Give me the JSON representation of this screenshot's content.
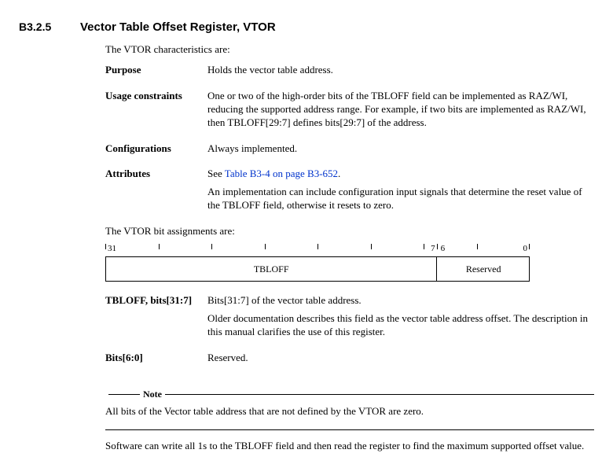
{
  "section": {
    "number": "B3.2.5",
    "title": "Vector Table Offset Register, VTOR"
  },
  "intro": "The VTOR characteristics are:",
  "characteristics": {
    "purpose": {
      "label": "Purpose",
      "text": "Holds the vector table address."
    },
    "usage": {
      "label": "Usage constraints",
      "text": "One or two of the high-order bits of the TBLOFF field can be implemented as RAZ/WI, reducing the supported address range. For example, if two bits are implemented as RAZ/WI, then TBLOFF[29:7] defines bits[29:7] of the address."
    },
    "config": {
      "label": "Configurations",
      "text": "Always implemented."
    },
    "attr": {
      "label": "Attributes",
      "see_prefix": "See ",
      "link_text": "Table B3-4 on page B3-652",
      "see_suffix": ".",
      "extra": "An implementation can include configuration input signals that determine the reset value of the TBLOFF field, otherwise it resets to zero."
    }
  },
  "bit_intro": "The VTOR bit assignments are:",
  "bitdiag": {
    "labels": {
      "hi": "31",
      "mid_hi": "7",
      "mid_lo": "6",
      "lo": "0"
    },
    "fields": {
      "tbloff": "TBLOFF",
      "reserved": "Reserved"
    }
  },
  "bitfields": {
    "tbloff": {
      "term": "TBLOFF, bits[31:7]",
      "p1": "Bits[31:7] of the vector table address.",
      "p2": "Older documentation describes this field as the vector table address offset. The description in this manual clarifies the use of this register."
    },
    "reserved": {
      "term": "Bits[6:0]",
      "p1": "Reserved."
    }
  },
  "note": {
    "heading": "Note",
    "para1": "All bits of the Vector table address that are not defined by the VTOR are zero."
  },
  "footnote": "Software can write all 1s to the TBLOFF field and then read the register to find the maximum supported offset value."
}
